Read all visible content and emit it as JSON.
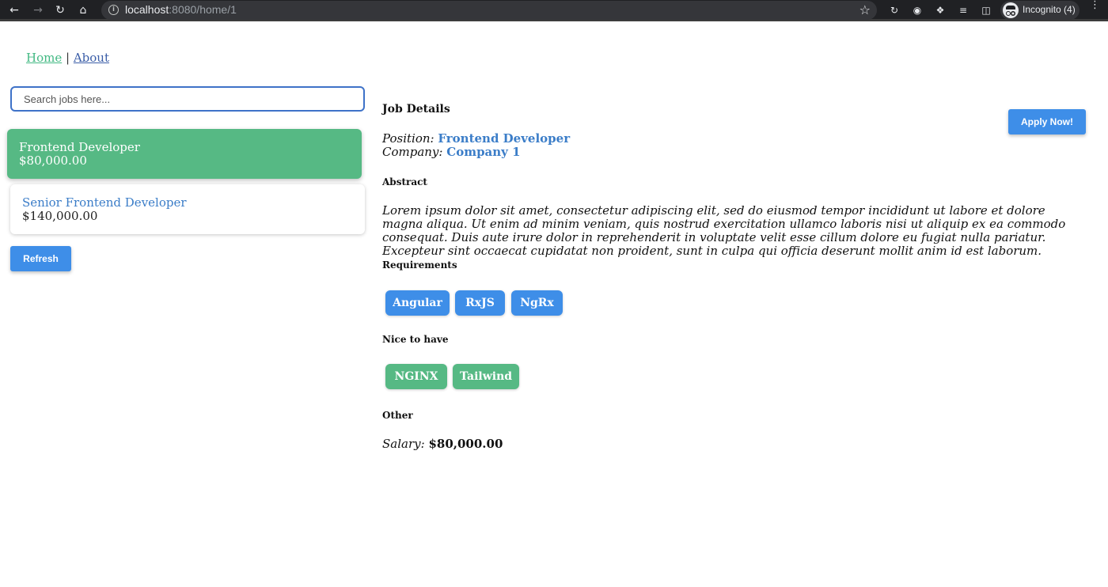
{
  "browser": {
    "url_host": "localhost",
    "url_rest": ":8080/home/1",
    "incognito_label": "Incognito (4)",
    "icons": [
      "back-icon",
      "forward-icon",
      "reload-icon",
      "home-icon",
      "info-icon",
      "star-icon",
      "extension-icon",
      "puzzle-icon",
      "reading-list-icon",
      "sidepanel-icon",
      "incognito-icon",
      "menu-icon"
    ]
  },
  "nav": {
    "home": "Home",
    "separator": "|",
    "about": "About"
  },
  "search": {
    "placeholder": "Search jobs here..."
  },
  "jobs": [
    {
      "title": "Frontend Developer",
      "salary": "$80,000.00"
    },
    {
      "title": "Senior Frontend Developer",
      "salary": "$140,000.00"
    }
  ],
  "refresh_label": "Refresh",
  "apply_label": "Apply Now!",
  "detail": {
    "heading": "Job Details",
    "position_label": "Position:",
    "position_value": "Frontend Developer",
    "company_label": "Company:",
    "company_value": "Company 1",
    "abstract_heading": "Abstract",
    "abstract_text": "Lorem ipsum dolor sit amet, consectetur adipiscing elit, sed do eiusmod tempor incididunt ut labore et dolore magna aliqua. Ut enim ad minim veniam, quis nostrud exercitation ullamco laboris nisi ut aliquip ex ea commodo consequat. Duis aute irure dolor in reprehenderit in voluptate velit esse cillum dolore eu fugiat nulla pariatur. Excepteur sint occaecat cupidatat non proident, sunt in culpa qui officia deserunt mollit anim id est laborum.",
    "requirements_heading": "Requirements",
    "requirements": [
      "Angular",
      "RxJS",
      "NgRx"
    ],
    "nice_heading": "Nice to have",
    "nice_to_have": [
      "NGINX",
      "Tailwind"
    ],
    "other_heading": "Other",
    "salary_label": "Salary:",
    "salary_value": "$80,000.00"
  },
  "colors": {
    "green": "#56b984",
    "blue": "#3e8ee8",
    "link_blue": "#3b7dc8"
  }
}
